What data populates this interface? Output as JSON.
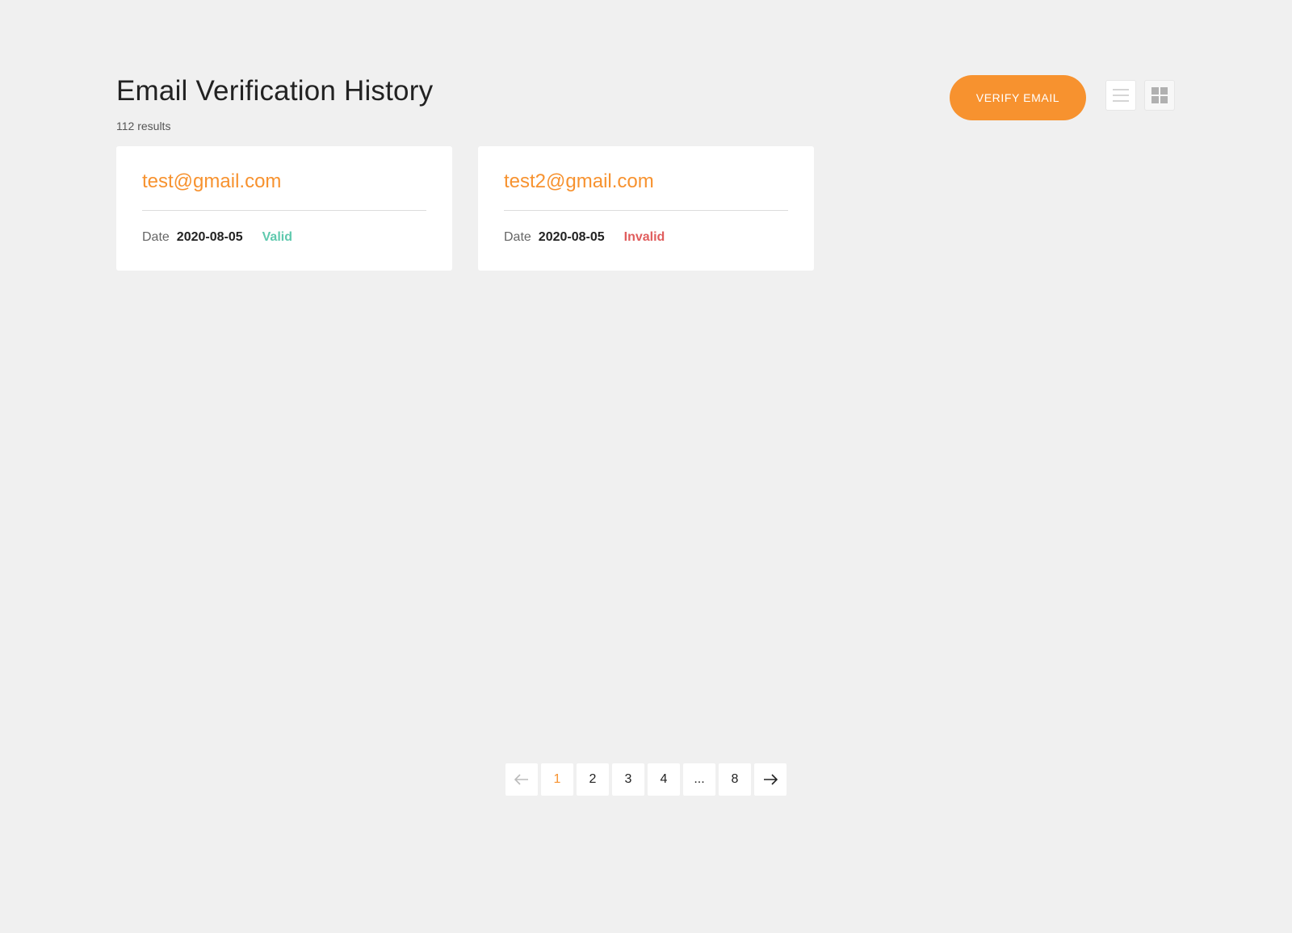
{
  "header": {
    "title": "Email Verification History",
    "results_count": "112 results"
  },
  "actions": {
    "verify_label": "VERIFY EMAIL",
    "view_modes": [
      "list",
      "grid"
    ],
    "active_view": "grid"
  },
  "cards": [
    {
      "email": "test@gmail.com",
      "date_label": "Date",
      "date": "2020-08-05",
      "status": "Valid"
    },
    {
      "email": "test2@gmail.com",
      "date_label": "Date",
      "date": "2020-08-05",
      "status": "Invalid"
    }
  ],
  "pagination": {
    "pages": [
      "1",
      "2",
      "3",
      "4",
      "...",
      "8"
    ],
    "current": "1",
    "prev_icon": "arrow-left-icon",
    "next_icon": "arrow-right-icon"
  },
  "colors": {
    "accent": "#f7922f",
    "valid": "#5fc9ae",
    "invalid": "#e05d5d",
    "background": "#f0f0f0"
  }
}
